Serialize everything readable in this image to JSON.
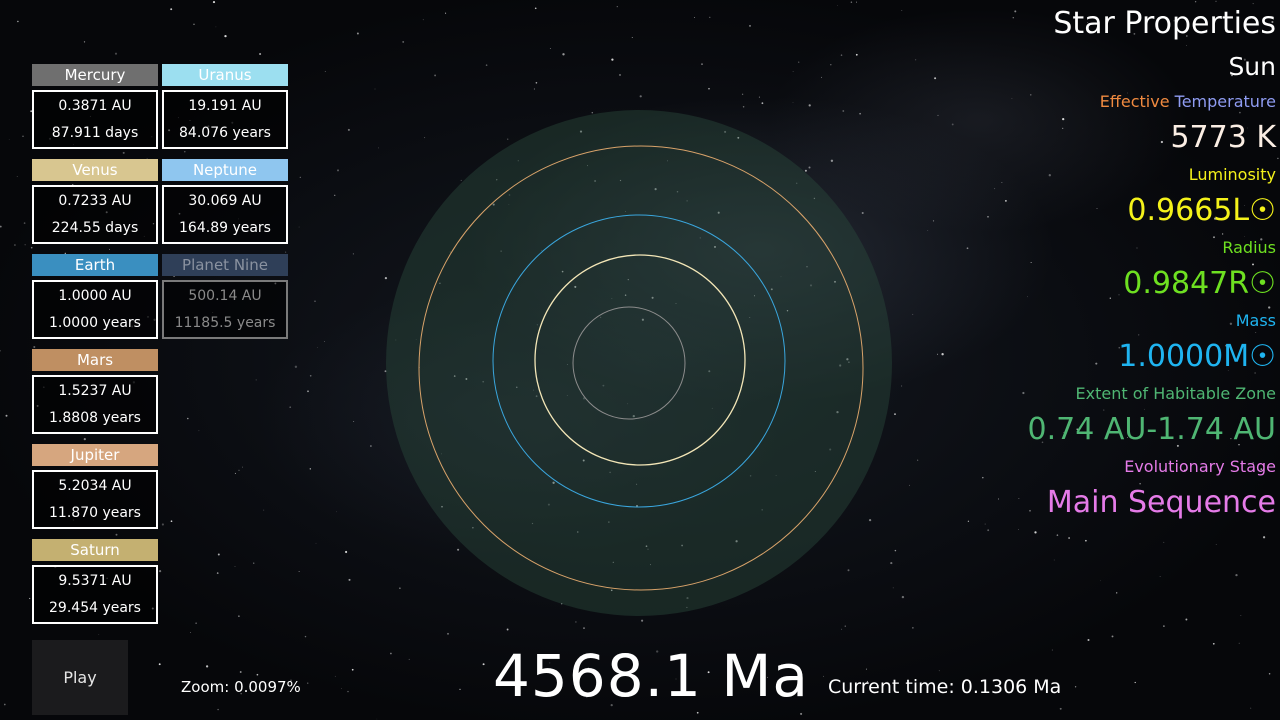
{
  "planets": [
    {
      "name": "Mercury",
      "distance": "0.3871 AU",
      "period": "87.911 days",
      "color": "#6f6f6f"
    },
    {
      "name": "Venus",
      "distance": "0.7233 AU",
      "period": "224.55 days",
      "color": "#d8c690"
    },
    {
      "name": "Earth",
      "distance": "1.0000 AU",
      "period": "1.0000 years",
      "color": "#3a8fc0"
    },
    {
      "name": "Mars",
      "distance": "1.5237 AU",
      "period": "1.8808 years",
      "color": "#bf8f62"
    },
    {
      "name": "Jupiter",
      "distance": "5.2034 AU",
      "period": "11.870 years",
      "color": "#d6a67f"
    },
    {
      "name": "Saturn",
      "distance": "9.5371 AU",
      "period": "29.454 years",
      "color": "#c4b071"
    },
    {
      "name": "Uranus",
      "distance": "19.191 AU",
      "period": "84.076 years",
      "color": "#9cdff0"
    },
    {
      "name": "Neptune",
      "distance": "30.069 AU",
      "period": "164.89 years",
      "color": "#8fc6ef"
    },
    {
      "name": "Planet Nine",
      "distance": "500.14 AU",
      "period": "11185.5 years",
      "color": "#2f3f58"
    }
  ],
  "star": {
    "section_title": "Star Properties",
    "name": "Sun",
    "temp_label_1": "Effective",
    "temp_label_2": "Temperature",
    "temp_value": "5773 K",
    "lum_label": "Luminosity",
    "lum_value": "0.9665L☉",
    "radius_label": "Radius",
    "radius_value": "0.9847R☉",
    "mass_label": "Mass",
    "mass_value": "1.0000M☉",
    "hz_label": "Extent of Habitable Zone",
    "hz_value": "0.74 AU-1.74 AU",
    "stage_label": "Evolutionary Stage",
    "stage_value": "Main Sequence",
    "colors": {
      "temp_1": "#f08a40",
      "temp_2": "#8f9cf2",
      "temp_value": "#fbeee4",
      "lum": "#f4f21a",
      "radius": "#6ee021",
      "mass": "#1fb4f0",
      "hz": "#4fb673",
      "stage": "#e57be8"
    }
  },
  "controls": {
    "play_label": "Play",
    "zoom_text": "Zoom: 0.0097%",
    "age_text": "4568.1 Ma",
    "current_time_text": "Current time: 0.1306 Ma"
  },
  "orbits": [
    {
      "planet": "Mercury",
      "color": "#8c8c8c"
    },
    {
      "planet": "Venus",
      "color": "#f3e6b7"
    },
    {
      "planet": "Earth",
      "color": "#3aa6dd"
    },
    {
      "planet": "Mars",
      "color": "#d9a36a"
    }
  ],
  "habitable_zone_color": "#2b4a3c"
}
